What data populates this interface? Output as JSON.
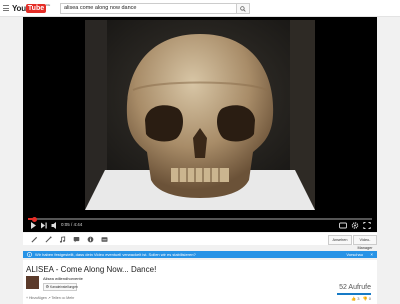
{
  "header": {
    "logo_you": "You",
    "logo_tube": "Tube",
    "logo_sup": "DE",
    "search_value": "alisea come along now dance"
  },
  "player": {
    "time": "0:05 / 4:44",
    "progress": 0.02,
    "action_buttons": [
      "Ansehen",
      "Video-Manager"
    ]
  },
  "banner": {
    "text": "Wir haben festgestellt, dass dein Video eventuell verwackelt ist. Sollen wir es stabilisieren?",
    "right_text": "Vorschau"
  },
  "video_info": {
    "title": "ALISEA - Come Along Now... Dance!",
    "channel": "Alisea willendhorvente",
    "subscribe_label": "Kanaleinstellungen",
    "views": "52 Aufrufe",
    "bottom_actions": "+ Hinzufügen   ↗ Teilen   ••• Mehr",
    "likes": "3",
    "dislikes": "0",
    "like_ratio": 1.0
  },
  "colors": {
    "accent_red": "#e52d27",
    "banner_blue": "#2793e6",
    "like_blue": "#167ac6"
  }
}
